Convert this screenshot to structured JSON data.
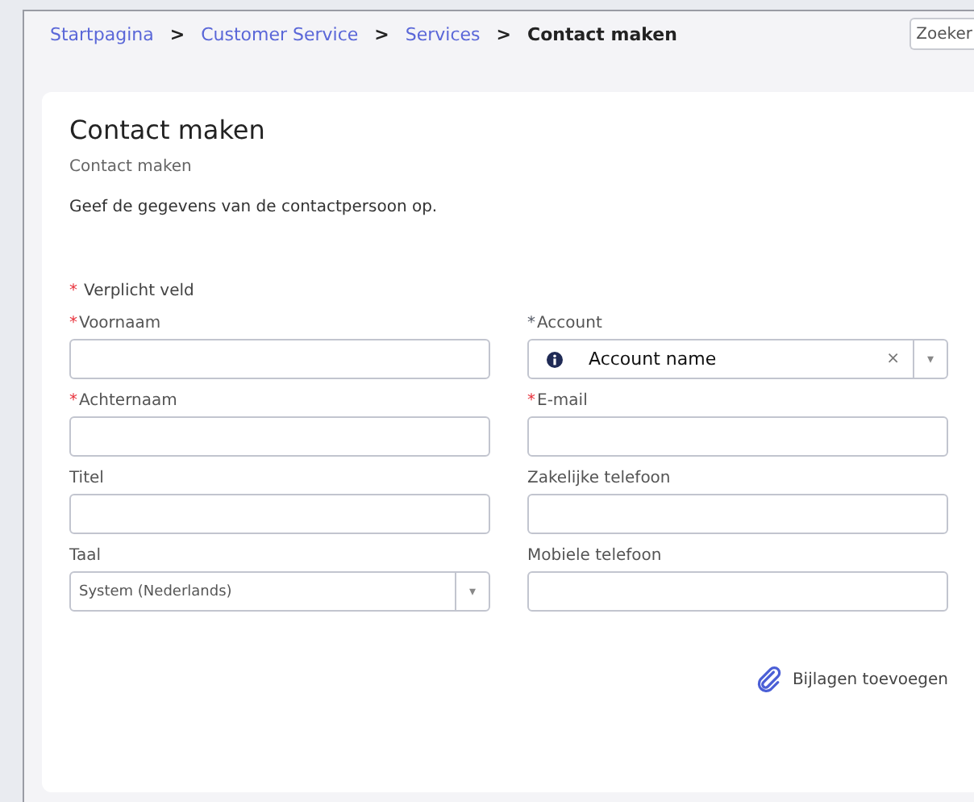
{
  "breadcrumb": [
    {
      "label": "Startpagina",
      "current": false
    },
    {
      "label": "Customer Service",
      "current": false
    },
    {
      "label": "Services",
      "current": false
    },
    {
      "label": "Contact maken",
      "current": true
    }
  ],
  "breadcrumb_separator": ">",
  "search": {
    "placeholder": "Zoeker"
  },
  "form": {
    "title": "Contact maken",
    "subtitle": "Contact maken",
    "instruction": "Geef de gegevens van de contactpersoon op.",
    "required_note": "Verplicht veld",
    "required_mark": "*",
    "fields": [
      {
        "label": "Voornaam",
        "kind": "text",
        "required": true,
        "color": "#e8303a"
      },
      {
        "label": "Account",
        "kind": "lookup",
        "required": true,
        "color": "#555a66",
        "value": "Account name",
        "clear": "×",
        "caret": "▾"
      },
      {
        "label": "Achternaam",
        "kind": "text",
        "required": true,
        "color": "#e8303a"
      },
      {
        "label": "E-mail",
        "kind": "text",
        "required": true,
        "color": "#e8303a"
      },
      {
        "label": "Titel",
        "kind": "text",
        "required": false
      },
      {
        "label": "Zakelijke telefoon",
        "kind": "text",
        "required": false
      },
      {
        "label": "Taal",
        "kind": "select",
        "required": false,
        "value": "System (Nederlands)",
        "caret": "▾"
      },
      {
        "label": "Mobiele telefoon",
        "kind": "text",
        "required": false
      }
    ],
    "attach": "Bijlagen toevoegen"
  }
}
